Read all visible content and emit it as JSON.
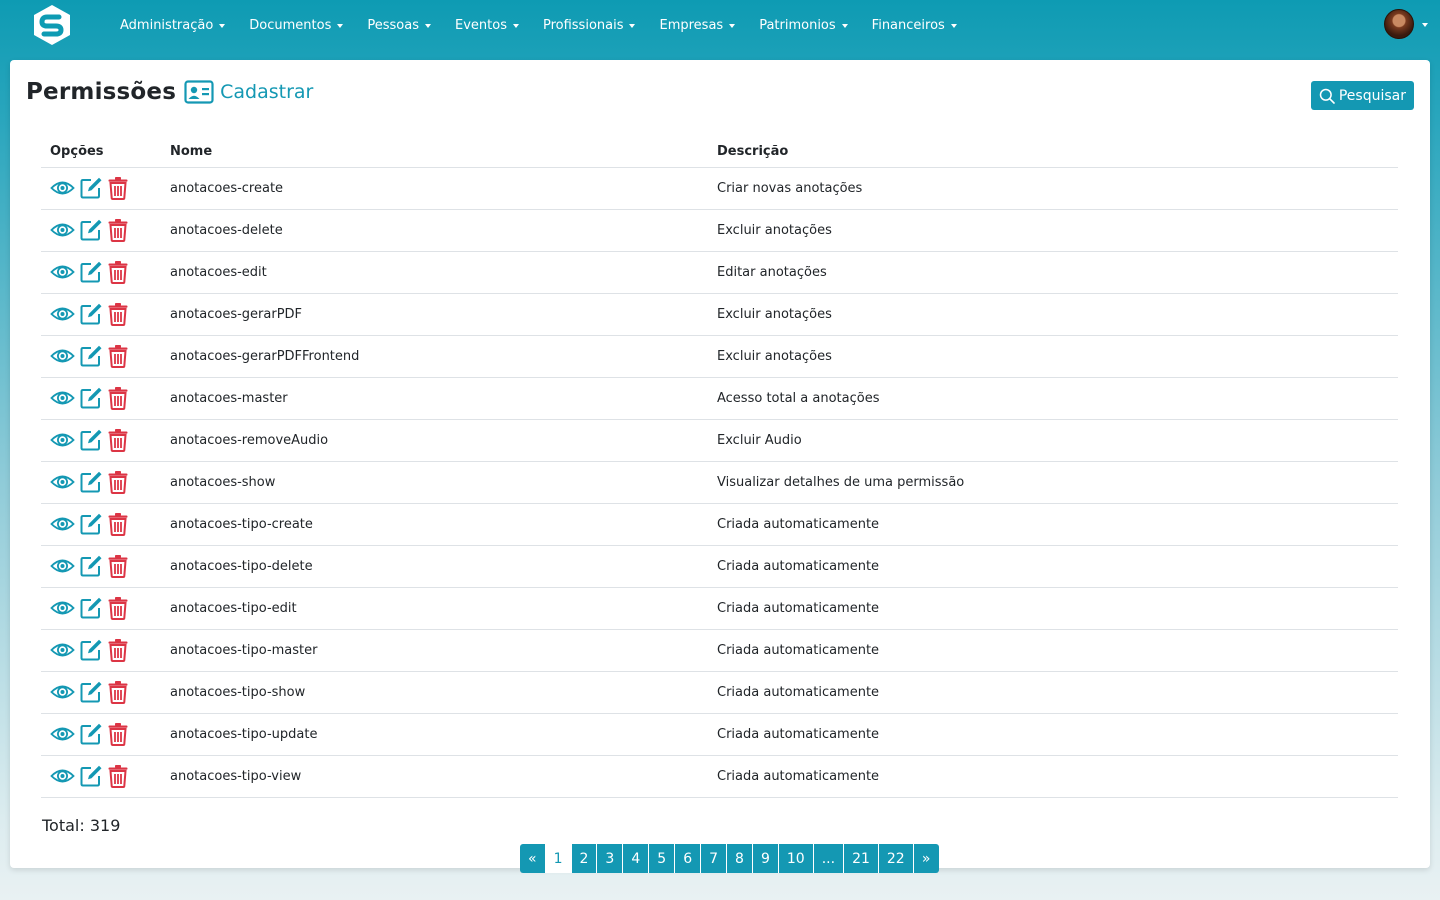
{
  "colors": {
    "primary": "#1498b3",
    "danger": "#dc3545",
    "navbar": "#0e9bb3"
  },
  "nav": {
    "logo_icon": "s-logo-icon",
    "items": [
      {
        "label": "Administração"
      },
      {
        "label": "Documentos"
      },
      {
        "label": "Pessoas"
      },
      {
        "label": "Eventos"
      },
      {
        "label": "Profissionais"
      },
      {
        "label": "Empresas"
      },
      {
        "label": "Patrimonios"
      },
      {
        "label": "Financeiros"
      }
    ],
    "user_icon": "avatar"
  },
  "page": {
    "title": "Permissões",
    "register_label": "Cadastrar",
    "register_icon": "id-card-icon",
    "search_label": "Pesquisar",
    "search_icon": "search-icon"
  },
  "table": {
    "headers": {
      "options": "Opções",
      "name": "Nome",
      "description": "Descrição"
    },
    "action_icons": [
      "eye-icon",
      "edit-icon",
      "trash-icon"
    ],
    "rows": [
      {
        "name": "anotacoes-create",
        "description": "Criar novas anotações"
      },
      {
        "name": "anotacoes-delete",
        "description": "Excluir anotações"
      },
      {
        "name": "anotacoes-edit",
        "description": "Editar anotações"
      },
      {
        "name": "anotacoes-gerarPDF",
        "description": "Excluir anotações"
      },
      {
        "name": "anotacoes-gerarPDFFrontend",
        "description": "Excluir anotações"
      },
      {
        "name": "anotacoes-master",
        "description": "Acesso total a anotações"
      },
      {
        "name": "anotacoes-removeAudio",
        "description": "Excluir Audio"
      },
      {
        "name": "anotacoes-show",
        "description": "Visualizar detalhes de uma permissão"
      },
      {
        "name": "anotacoes-tipo-create",
        "description": "Criada automaticamente"
      },
      {
        "name": "anotacoes-tipo-delete",
        "description": "Criada automaticamente"
      },
      {
        "name": "anotacoes-tipo-edit",
        "description": "Criada automaticamente"
      },
      {
        "name": "anotacoes-tipo-master",
        "description": "Criada automaticamente"
      },
      {
        "name": "anotacoes-tipo-show",
        "description": "Criada automaticamente"
      },
      {
        "name": "anotacoes-tipo-update",
        "description": "Criada automaticamente"
      },
      {
        "name": "anotacoes-tipo-view",
        "description": "Criada automaticamente"
      }
    ]
  },
  "total": "Total: 319",
  "pagination": {
    "prev": "«",
    "pages": [
      "1",
      "2",
      "3",
      "4",
      "5",
      "6",
      "7",
      "8",
      "9",
      "10",
      "...",
      "21",
      "22"
    ],
    "active": "1",
    "next": "»"
  }
}
